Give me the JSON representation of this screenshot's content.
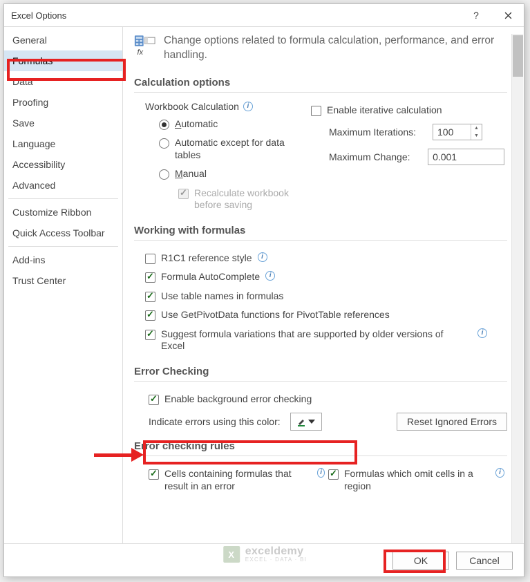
{
  "title": "Excel Options",
  "sidebar": {
    "items": [
      {
        "label": "General"
      },
      {
        "label": "Formulas",
        "selected": true
      },
      {
        "label": "Data"
      },
      {
        "label": "Proofing"
      },
      {
        "label": "Save"
      },
      {
        "label": "Language"
      },
      {
        "label": "Accessibility"
      },
      {
        "label": "Advanced"
      },
      {
        "label": "Customize Ribbon"
      },
      {
        "label": "Quick Access Toolbar"
      },
      {
        "label": "Add-ins"
      },
      {
        "label": "Trust Center"
      }
    ]
  },
  "intro": "Change options related to formula calculation, performance, and error handling.",
  "sections": {
    "calc": {
      "title": "Calculation options",
      "wb_label": "Workbook Calculation",
      "opts": {
        "auto": "Automatic",
        "auto_except": "Automatic except for data tables",
        "manual": "Manual",
        "recalc": "Recalculate workbook before saving"
      },
      "iter_enable": "Enable iterative calculation",
      "max_iter_label": "Maximum Iterations:",
      "max_iter_value": "100",
      "max_change_label": "Maximum Change:",
      "max_change_value": "0.001"
    },
    "working": {
      "title": "Working with formulas",
      "r1c1": "R1C1 reference style",
      "autocomplete": "Formula AutoComplete",
      "tablenames": "Use table names in formulas",
      "getpivot": "Use GetPivotData functions for PivotTable references",
      "suggest": "Suggest formula variations that are supported by older versions of Excel"
    },
    "errcheck": {
      "title": "Error Checking",
      "bg": "Enable background error checking",
      "indicate": "Indicate errors using this color:",
      "reset": "Reset Ignored Errors"
    },
    "rules": {
      "title": "Error checking rules",
      "cells": "Cells containing formulas that result in an error",
      "omit": "Formulas which omit cells in a region"
    }
  },
  "footer": {
    "ok": "OK",
    "cancel": "Cancel"
  },
  "watermark": {
    "brand": "exceldemy",
    "tagline": "EXCEL · DATA · BI"
  }
}
